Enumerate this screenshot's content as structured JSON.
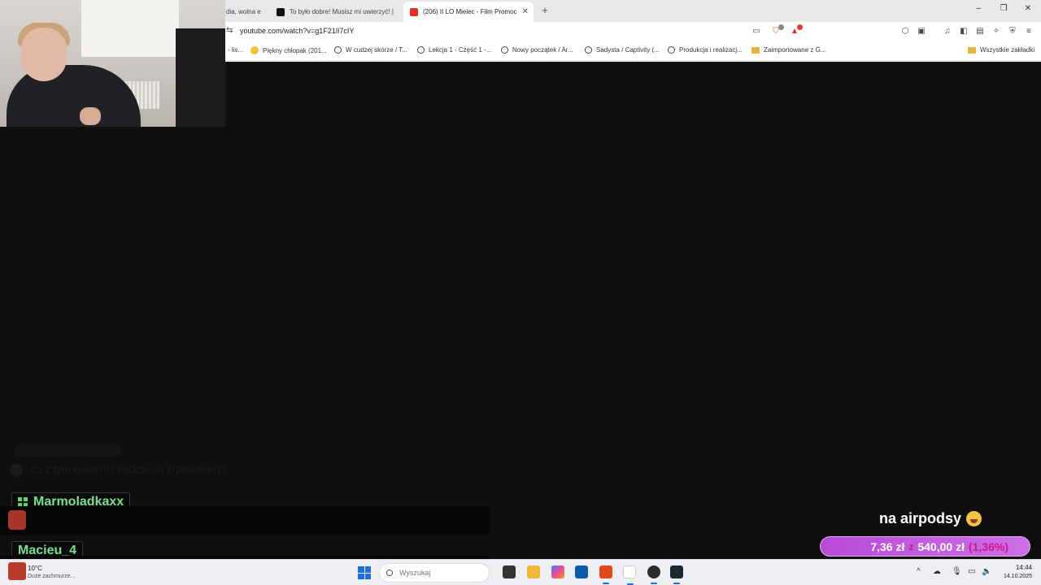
{
  "browser": {
    "tabs": [
      {
        "label": "dia, wolna e",
        "icon": "generic-tab-icon"
      },
      {
        "label": "To było dobre! Musisz mi uwierzyć! |",
        "icon": "tiktok-icon"
      },
      {
        "label": "(206) II LO Mielec - Film Promoc",
        "icon": "youtube-icon",
        "active": true
      }
    ],
    "address": "youtube.com/watch?v=g1F21lI7cIY",
    "bookmarks": [
      "- lis...",
      "Piękny chłopak (201...",
      "W cudzej skórze / T...",
      "Lekcja 1 - Część 1 -...",
      "Nowy początek / Ar...",
      "Sadysta / Captivity (...",
      "Produkcja i realizacj...",
      "Zaimportowane z G...",
      "Wszystkie zakładki"
    ]
  },
  "chat": {
    "ghost_message": "co z tym kolkiem? będzie na krzesełkie()?",
    "users": [
      "Marmoladkaxx",
      "Macieu_4"
    ]
  },
  "donation": {
    "message": "na airpodsy",
    "current": "7,36 zł",
    "separator": "z",
    "goal": "540,00 zł",
    "percent": "(1,36%)",
    "progress": 0.0136
  },
  "taskbar": {
    "temperature": "10°C",
    "weather_desc": "Duże zachmurze...",
    "search_placeholder": "Wyszukaj",
    "time": "14:44",
    "date": "14.10.2025"
  },
  "colors": {
    "accent": "#1e6fd9",
    "chat_name": "#77e08c",
    "donation_bar": "#b94ad8",
    "donation_percent": "#d0168d"
  }
}
